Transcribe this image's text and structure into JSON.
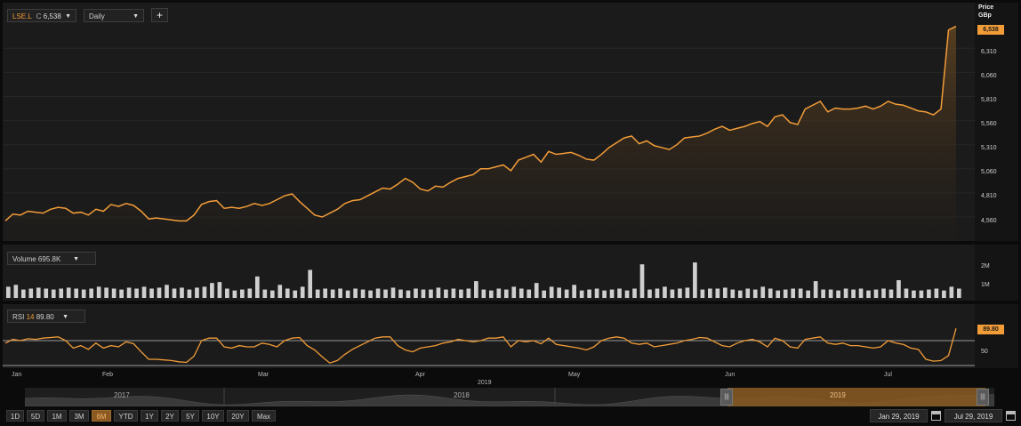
{
  "toolbar": {
    "symbol": "LSE.L",
    "symbol_suffix": "C",
    "symbol_value": "6,538",
    "interval": "Daily",
    "add_label": "+"
  },
  "price_axis": {
    "title_line1": "Price",
    "title_line2": "GBp",
    "last_value": "6,538",
    "ticks": [
      "6,310",
      "6,060",
      "5,810",
      "5,560",
      "5,310",
      "5,060",
      "4,810",
      "4,560"
    ]
  },
  "volume": {
    "label": "Volume",
    "value": "695.8K",
    "ticks": [
      "2M",
      "1M"
    ]
  },
  "rsi": {
    "label": "RSI",
    "period": "14",
    "value": "89.80",
    "last_value": "89.80",
    "ticks": [
      "50"
    ]
  },
  "x_axis": {
    "months": [
      "Jan",
      "Feb",
      "Mar",
      "Apr",
      "May",
      "Jun",
      "Jul"
    ],
    "year": "2019"
  },
  "navigator": {
    "years": [
      "2017",
      "2018",
      "2019"
    ]
  },
  "range_buttons": [
    "1D",
    "5D",
    "1M",
    "3M",
    "6M",
    "YTD",
    "1Y",
    "2Y",
    "5Y",
    "10Y",
    "20Y",
    "Max"
  ],
  "active_range": "6M",
  "date_range": {
    "from": "Jan 29, 2019",
    "to": "Jul 29, 2019"
  },
  "colors": {
    "accent": "#f29c38",
    "background": "#1b1b1b",
    "rsi_band": "#9a9a9a",
    "volume_bar": "#cfcfcf"
  },
  "chart_data": [
    {
      "type": "area",
      "series": [
        {
          "values": [
            4520,
            4590,
            4580,
            4620,
            4610,
            4600,
            4640,
            4660,
            4650,
            4600,
            4610,
            4580,
            4640,
            4620,
            4690,
            4670,
            4700,
            4680,
            4620,
            4540,
            4550,
            4540,
            4530,
            4520,
            4520,
            4580,
            4690,
            4720,
            4730,
            4650,
            4660,
            4650,
            4670,
            4700,
            4680,
            4700,
            4740,
            4780,
            4800,
            4720,
            4650,
            4580,
            4560,
            4600,
            4640,
            4700,
            4730,
            4740,
            4780,
            4820,
            4860,
            4850,
            4900,
            4960,
            4920,
            4850,
            4830,
            4880,
            4870,
            4920,
            4960,
            4980,
            5000,
            5060,
            5060,
            5080,
            5100,
            5040,
            5150,
            5180,
            5210,
            5130,
            5240,
            5210,
            5220,
            5230,
            5200,
            5160,
            5150,
            5210,
            5280,
            5330,
            5380,
            5400,
            5320,
            5350,
            5300,
            5280,
            5260,
            5310,
            5380,
            5390,
            5400,
            5430,
            5470,
            5500,
            5460,
            5480,
            5500,
            5530,
            5550,
            5500,
            5600,
            5620,
            5540,
            5520,
            5680,
            5720,
            5760,
            5650,
            5690,
            5680,
            5680,
            5690,
            5710,
            5680,
            5710,
            5760,
            5730,
            5720,
            5690,
            5660,
            5650,
            5620,
            5680,
            6500,
            6538
          ],
          "last": 6538
        }
      ],
      "ylim": [
        4450,
        6600
      ],
      "x_range": [
        "Jan 2019",
        "Jul 29, 2019"
      ]
    },
    {
      "type": "bar",
      "series": [
        {
          "name": "Volume",
          "values": [
            0.6,
            0.7,
            0.45,
            0.5,
            0.55,
            0.5,
            0.45,
            0.5,
            0.55,
            0.5,
            0.45,
            0.5,
            0.6,
            0.55,
            0.5,
            0.45,
            0.55,
            0.5,
            0.6,
            0.5,
            0.55,
            0.7,
            0.5,
            0.55,
            0.45,
            0.55,
            0.6,
            0.8,
            0.85,
            0.5,
            0.4,
            0.45,
            0.5,
            0.5,
            0.45,
            0.4,
            0.7,
            0.5,
            0.4,
            0.6,
            0.9,
            0.45,
            0.5,
            0.45,
            0.5,
            0.4,
            0.5,
            0.45,
            0.4,
            0.5,
            0.45,
            0.55,
            0.45,
            0.4,
            0.5,
            0.45,
            0.45,
            0.55,
            0.45,
            0.5,
            0.45,
            0.5,
            0.5,
            0.45,
            0.4,
            0.5,
            0.45,
            0.6,
            0.5,
            0.45,
            0.8,
            0.4,
            0.6,
            0.55,
            0.45,
            0.55,
            0.4,
            0.45,
            0.5,
            0.4,
            0.45,
            0.5,
            0.4,
            0.5,
            0.4,
            0.45,
            0.5,
            0.6,
            0.45,
            0.5,
            0.55,
            0.5,
            0.45,
            0.5,
            0.5,
            0.55,
            0.45,
            0.4,
            0.5,
            0.45,
            0.6,
            0.5,
            0.4,
            0.45,
            0.5,
            0.5,
            0.4,
            0.9,
            0.45,
            0.45,
            0.4,
            0.5,
            0.45,
            0.5,
            0.4,
            0.45,
            0.5,
            0.45,
            0.55,
            0.5,
            0.4,
            0.4,
            0.45,
            0.5,
            0.4,
            0.6,
            0.5
          ],
          "spikes": {
            "33": 1.15,
            "40": 1.5,
            "62": 0.9,
            "75": 0.7,
            "84": 1.8,
            "91": 1.9,
            "118": 0.95,
            "134": 1.25,
            "148": 0.75,
            "160": 1.0,
            "177": 1.3
          }
        }
      ],
      "ticks": [
        "1M",
        "2M"
      ],
      "unit": "shares"
    },
    {
      "type": "line",
      "series": [
        {
          "name": "RSI",
          "values": [
            66,
            72,
            70,
            73,
            72,
            74,
            75,
            76,
            70,
            58,
            62,
            56,
            66,
            58,
            62,
            60,
            68,
            65,
            52,
            40,
            40,
            39,
            38,
            36,
            35,
            45,
            70,
            74,
            74,
            60,
            58,
            62,
            60,
            60,
            66,
            64,
            60,
            70,
            74,
            75,
            62,
            55,
            44,
            34,
            38,
            48,
            56,
            62,
            68,
            74,
            76,
            76,
            62,
            55,
            52,
            58,
            60,
            62,
            66,
            68,
            72,
            70,
            68,
            70,
            74,
            74,
            76,
            60,
            70,
            68,
            70,
            65,
            74,
            64,
            62,
            60,
            58,
            55,
            60,
            70,
            74,
            76,
            74,
            66,
            64,
            66,
            60,
            62,
            64,
            66,
            70,
            72,
            75,
            74,
            68,
            62,
            60,
            66,
            70,
            72,
            68,
            60,
            74,
            70,
            60,
            58,
            72,
            74,
            76,
            66,
            64,
            66,
            62,
            62,
            60,
            58,
            60,
            70,
            66,
            64,
            58,
            56,
            40,
            37,
            38,
            46,
            89.8
          ]
        }
      ],
      "ylim": [
        20,
        100
      ],
      "bands": [
        70,
        30
      ],
      "last": 89.8
    }
  ]
}
